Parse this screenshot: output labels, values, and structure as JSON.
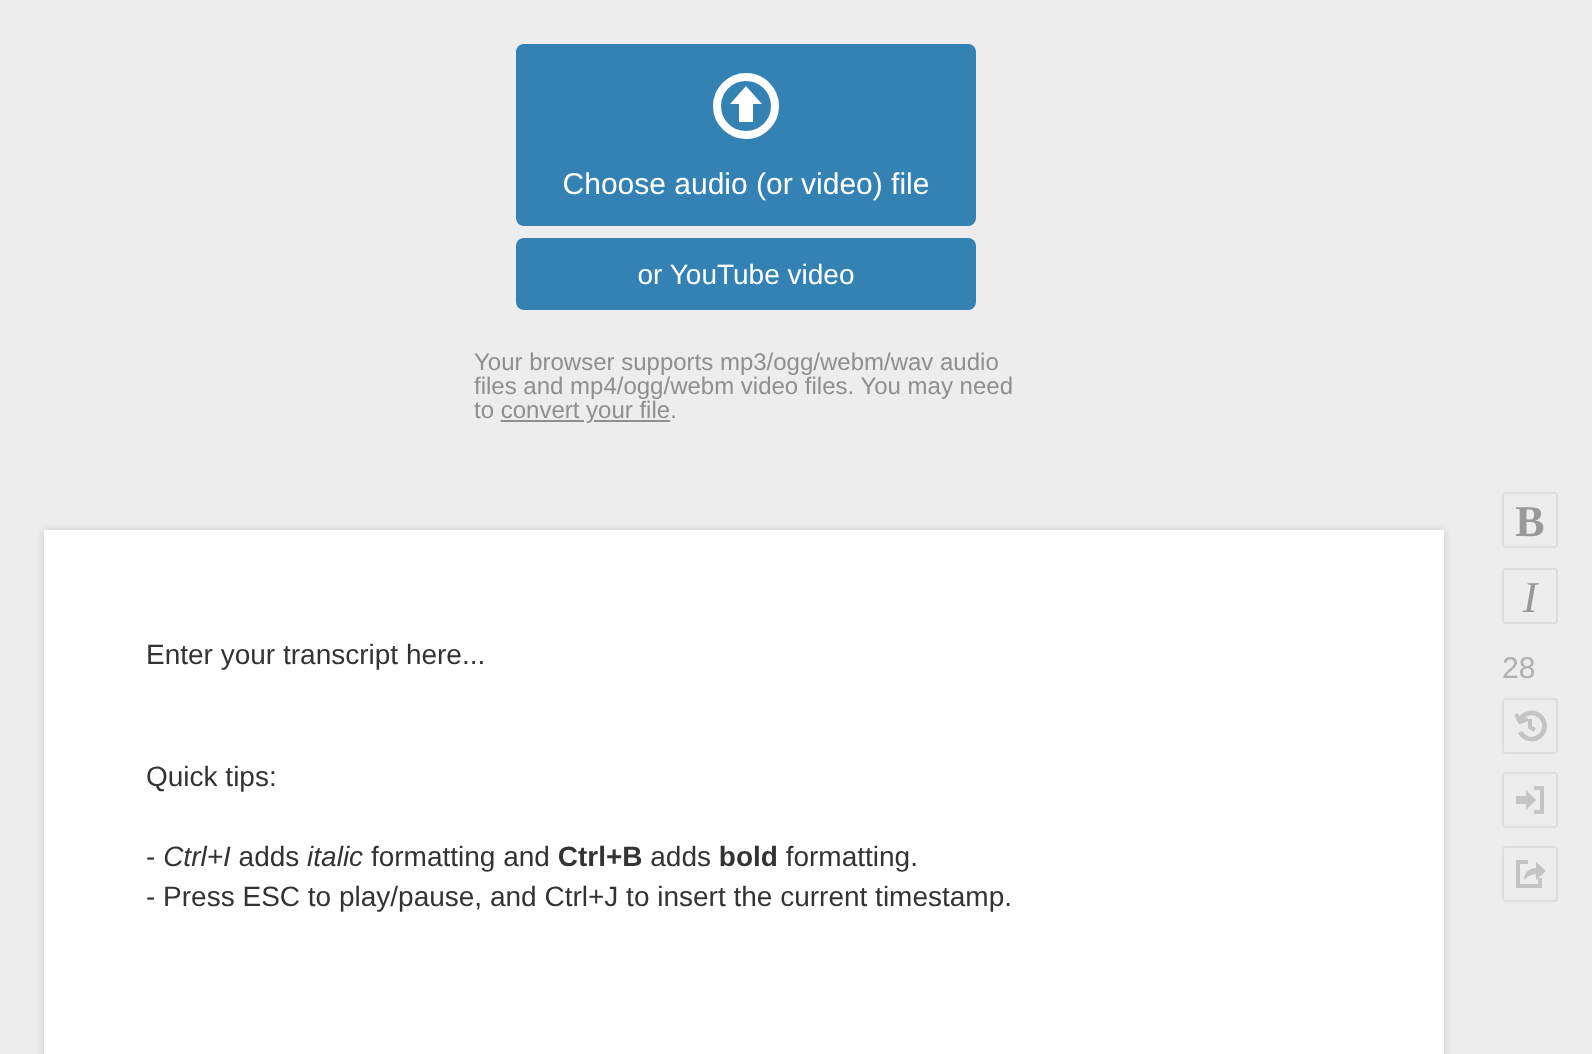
{
  "upload": {
    "file_button": "Choose audio (or video) file",
    "youtube_button": "or YouTube video",
    "note": {
      "text": "Your browser supports mp3/ogg/webm/wav audio files and mp4/ogg/webm video files. You may need to",
      "link": "convert your file",
      "after": "."
    }
  },
  "editor": {
    "placeholder": "Enter your transcript here...",
    "tips_title": "Quick tips:",
    "tips": [
      "- *Ctrl+I* adds *italic* formatting and **Ctrl+B** adds **bold** formatting.",
      "- Press ESC to play/pause, and Ctrl+J to insert the current timestamp."
    ]
  },
  "toolbar": {
    "bold": "B",
    "italic": "I",
    "font_size": "28"
  }
}
